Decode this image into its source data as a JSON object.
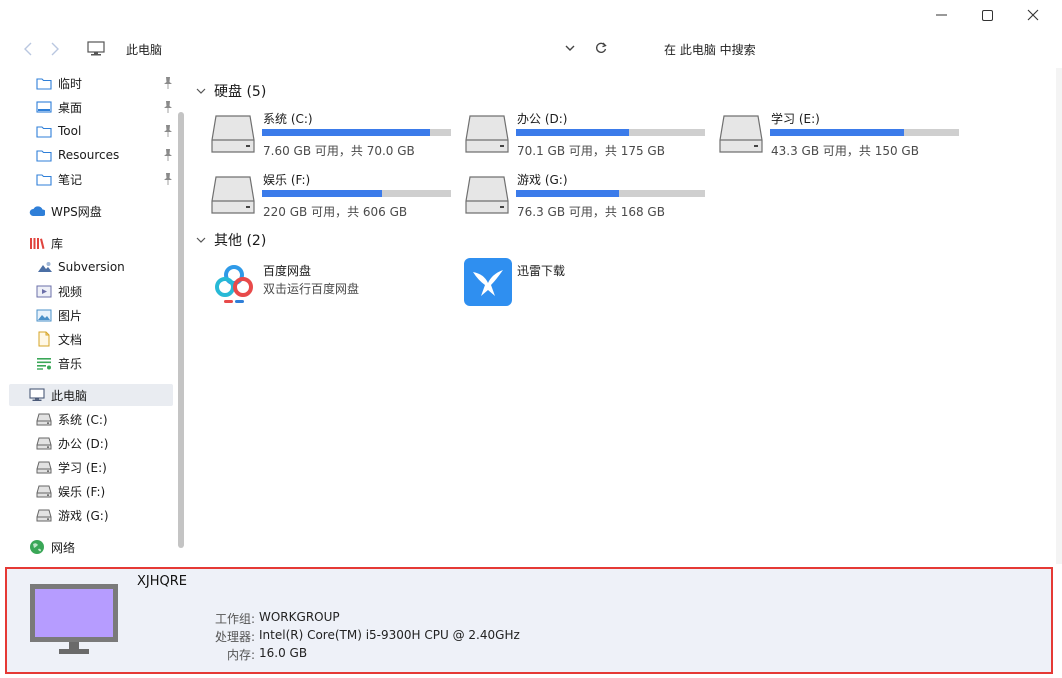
{
  "window": {
    "controls": {
      "minimize": "minimize",
      "maximize": "maximize",
      "close": "close"
    }
  },
  "address_bar": {
    "location": "此电脑",
    "search_placeholder": "在 此电脑 中搜索"
  },
  "sidebar": {
    "quick_access": [
      {
        "label": "临时",
        "icon": "folder-icon",
        "pinned": true
      },
      {
        "label": "桌面",
        "icon": "desktop-icon",
        "pinned": true
      },
      {
        "label": "Tool",
        "icon": "folder-icon",
        "pinned": true
      },
      {
        "label": "Resources",
        "icon": "folder-icon",
        "pinned": true
      },
      {
        "label": "笔记",
        "icon": "folder-icon",
        "pinned": true
      }
    ],
    "wps": "WPS网盘",
    "library": "库",
    "library_items": [
      {
        "label": "Subversion",
        "icon": "subversion-icon"
      },
      {
        "label": "视频",
        "icon": "video-icon"
      },
      {
        "label": "图片",
        "icon": "picture-icon"
      },
      {
        "label": "文档",
        "icon": "document-icon"
      },
      {
        "label": "音乐",
        "icon": "music-icon"
      }
    ],
    "this_pc": "此电脑",
    "drives": [
      {
        "label": "系统 (C:)"
      },
      {
        "label": "办公 (D:)"
      },
      {
        "label": "学习 (E:)"
      },
      {
        "label": "娱乐 (F:)"
      },
      {
        "label": "游戏 (G:)"
      }
    ],
    "network": "网络"
  },
  "main": {
    "drives_group": "硬盘 (5)",
    "drives": [
      {
        "name": "系统 (C:)",
        "size": "7.60 GB 可用，共 70.0 GB",
        "used_fraction": 0.891
      },
      {
        "name": "办公 (D:)",
        "size": "70.1 GB 可用，共 175 GB",
        "used_fraction": 0.599
      },
      {
        "name": "学习 (E:)",
        "size": "43.3 GB 可用，共 150 GB",
        "used_fraction": 0.711
      },
      {
        "name": "娱乐 (F:)",
        "size": "220 GB 可用，共 606 GB",
        "used_fraction": 0.637
      },
      {
        "name": "游戏 (G:)",
        "size": "76.3 GB 可用，共 168 GB",
        "used_fraction": 0.546
      }
    ],
    "other_group": "其他 (2)",
    "apps": [
      {
        "name": "百度网盘",
        "desc": "双击运行百度网盘"
      },
      {
        "name": "迅雷下载",
        "desc": ""
      }
    ]
  },
  "details": {
    "computer_name": "XJHQRE",
    "workgroup_label": "工作组:",
    "workgroup": "WORKGROUP",
    "processor_label": "处理器:",
    "processor": "Intel(R) Core(TM) i5-9300H CPU @ 2.40GHz",
    "memory_label": "内存:",
    "memory": "16.0 GB"
  },
  "colors": {
    "accent": "#3b7bea",
    "selection": "#e9ecf1",
    "details_bg": "#eef1f8",
    "highlight_border": "#e53935"
  }
}
